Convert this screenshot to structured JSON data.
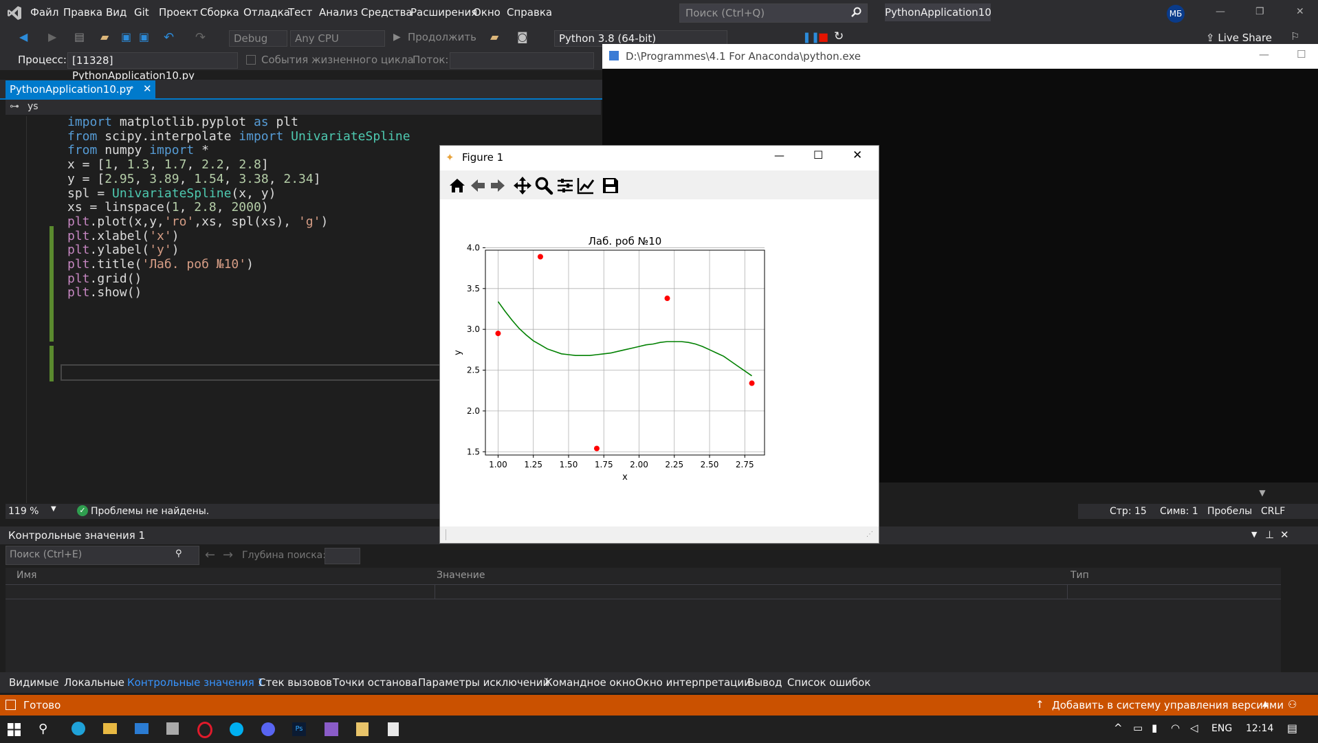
{
  "menu": {
    "items": [
      "Файл",
      "Правка",
      "Вид",
      "Git",
      "Проект",
      "Сборка",
      "Отладка",
      "Тест",
      "Анализ",
      "Средства",
      "Расширения",
      "Окно",
      "Справка"
    ],
    "search_placeholder": "Поиск (Ctrl+Q)",
    "solution": "PythonApplication10",
    "avatar": "МБ"
  },
  "toolbar": {
    "config": "Debug",
    "platform": "Any CPU",
    "continue_label": "Продолжить",
    "interpreter": "Python 3.8 (64-bit)",
    "live_share": "Live Share",
    "process_label": "Процесс:",
    "process_value": "[11328] PythonApplication10.py",
    "lifecycle_label": "События жизненного цикла",
    "thread_label": "Поток:"
  },
  "editor": {
    "tab_title": "PythonApplication10.py",
    "nav_scope": "ys",
    "zoom": "119 %",
    "issues": "Проблемы не найдены."
  },
  "code": [
    [
      [
        "kw",
        "import"
      ],
      [
        "id",
        " matplotlib.pyplot "
      ],
      [
        "kw",
        "as"
      ],
      [
        "id",
        " plt"
      ]
    ],
    [
      [
        "kw",
        "from"
      ],
      [
        "id",
        " scipy.interpolate "
      ],
      [
        "kw",
        "import"
      ],
      [
        "mod",
        " UnivariateSpline"
      ]
    ],
    [
      [
        "kw",
        "from"
      ],
      [
        "id",
        " numpy "
      ],
      [
        "kw",
        "import"
      ],
      [
        "id",
        " *"
      ]
    ],
    [
      [
        "id",
        "x = ["
      ],
      [
        "num",
        "1"
      ],
      [
        "id",
        ", "
      ],
      [
        "num",
        "1.3"
      ],
      [
        "id",
        ", "
      ],
      [
        "num",
        "1.7"
      ],
      [
        "id",
        ", "
      ],
      [
        "num",
        "2.2"
      ],
      [
        "id",
        ", "
      ],
      [
        "num",
        "2.8"
      ],
      [
        "id",
        "]"
      ]
    ],
    [
      [
        "id",
        "y = ["
      ],
      [
        "num",
        "2.95"
      ],
      [
        "id",
        ", "
      ],
      [
        "num",
        "3.89"
      ],
      [
        "id",
        ", "
      ],
      [
        "num",
        "1.54"
      ],
      [
        "id",
        ", "
      ],
      [
        "num",
        "3.38"
      ],
      [
        "id",
        ", "
      ],
      [
        "num",
        "2.34"
      ],
      [
        "id",
        "]"
      ]
    ],
    [
      [
        "id",
        "spl = "
      ],
      [
        "mod",
        "UnivariateSpline"
      ],
      [
        "id",
        "(x, y)"
      ]
    ],
    [
      [
        "id",
        "xs = linspace("
      ],
      [
        "num",
        "1"
      ],
      [
        "id",
        ", "
      ],
      [
        "num",
        "2.8"
      ],
      [
        "id",
        ", "
      ],
      [
        "num",
        "2000"
      ],
      [
        "id",
        ")"
      ]
    ],
    [
      [
        "pur",
        "plt"
      ],
      [
        "id",
        ".plot(x,y,"
      ],
      [
        "str",
        "'ro'"
      ],
      [
        "id",
        ",xs, spl(xs), "
      ],
      [
        "str",
        "'g'"
      ],
      [
        "id",
        ")"
      ]
    ],
    [
      [
        "pur",
        "plt"
      ],
      [
        "id",
        ".xlabel("
      ],
      [
        "str",
        "'x'"
      ],
      [
        "id",
        ")"
      ]
    ],
    [
      [
        "pur",
        "plt"
      ],
      [
        "id",
        ".ylabel("
      ],
      [
        "str",
        "'y'"
      ],
      [
        "id",
        ")"
      ]
    ],
    [
      [
        "pur",
        "plt"
      ],
      [
        "id",
        ".title("
      ],
      [
        "str",
        "'Лаб. роб №10'"
      ],
      [
        "id",
        ")"
      ]
    ],
    [
      [
        "pur",
        "plt"
      ],
      [
        "id",
        ".grid()"
      ]
    ],
    [
      [
        "pur",
        "plt"
      ],
      [
        "id",
        ".show()"
      ]
    ]
  ],
  "console": {
    "title": "D:\\Programmes\\4.1 For Anaconda\\python.exe"
  },
  "editor_status": {
    "line": "Стр: 15",
    "col": "Симв: 1",
    "spaces": "Пробелы",
    "eol": "CRLF"
  },
  "watch": {
    "title": "Контрольные значения 1",
    "search_placeholder": "Поиск (Ctrl+E)",
    "depth_label": "Глубина поиска:",
    "columns": [
      "Имя",
      "Значение",
      "Тип"
    ]
  },
  "bottom_tabs": [
    "Видимые",
    "Локальные",
    "Контрольные значения 1",
    "Стек вызовов",
    "Точки останова",
    "Параметры исключений",
    "Командное окно",
    "Окно интерпретации",
    "Вывод",
    "Список ошибок"
  ],
  "status": {
    "ready": "Готово",
    "vcs": "Добавить в систему управления версиями"
  },
  "taskbar": {
    "lang": "ENG",
    "time": "12:14"
  },
  "figure": {
    "window_title": "Figure 1"
  },
  "chart_data": {
    "type": "line",
    "title": "Лаб. роб №10",
    "xlabel": "x",
    "ylabel": "y",
    "xlim": [
      0.91,
      2.89
    ],
    "ylim": [
      1.46,
      3.97
    ],
    "xticks": [
      "1.00",
      "1.25",
      "1.50",
      "1.75",
      "2.00",
      "2.25",
      "2.50",
      "2.75"
    ],
    "yticks": [
      "1.5",
      "2.0",
      "2.5",
      "3.0",
      "3.5",
      "4.0"
    ],
    "grid": true,
    "series": [
      {
        "style": "points",
        "color": "#ff0000",
        "x": [
          1.0,
          1.3,
          1.7,
          2.2,
          2.8
        ],
        "y": [
          2.95,
          3.89,
          1.54,
          3.38,
          2.34
        ]
      },
      {
        "style": "line",
        "color": "#008000",
        "x": [
          1.0,
          1.05,
          1.1,
          1.15,
          1.2,
          1.25,
          1.3,
          1.35,
          1.4,
          1.45,
          1.5,
          1.55,
          1.6,
          1.65,
          1.7,
          1.75,
          1.8,
          1.85,
          1.9,
          1.95,
          2.0,
          2.05,
          2.1,
          2.15,
          2.2,
          2.25,
          2.3,
          2.35,
          2.4,
          2.45,
          2.5,
          2.55,
          2.6,
          2.65,
          2.7,
          2.75,
          2.8
        ],
        "y": [
          3.34,
          3.22,
          3.11,
          3.01,
          2.93,
          2.86,
          2.81,
          2.76,
          2.73,
          2.7,
          2.69,
          2.68,
          2.68,
          2.68,
          2.69,
          2.7,
          2.71,
          2.73,
          2.75,
          2.77,
          2.79,
          2.81,
          2.82,
          2.84,
          2.85,
          2.85,
          2.85,
          2.84,
          2.82,
          2.79,
          2.75,
          2.71,
          2.67,
          2.61,
          2.55,
          2.49,
          2.43
        ]
      }
    ]
  }
}
